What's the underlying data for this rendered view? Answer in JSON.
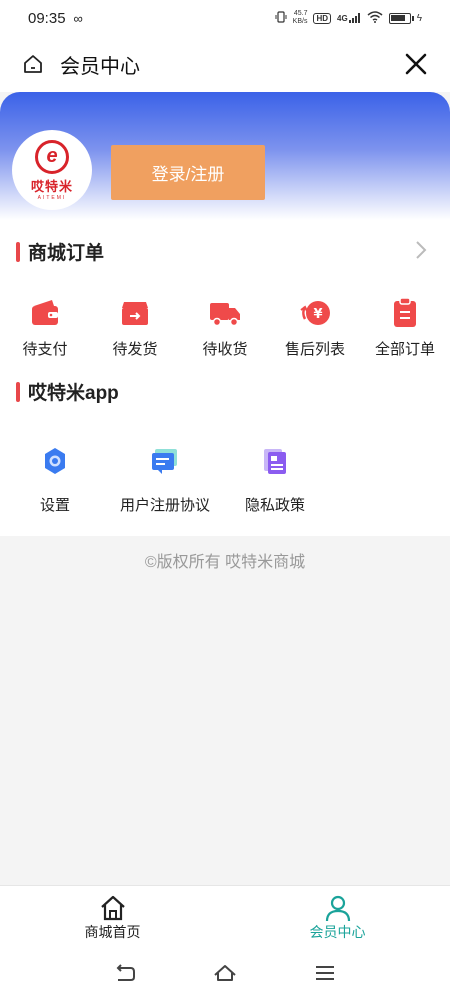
{
  "status_bar": {
    "time": "09:35",
    "net_speed_value": "45.7",
    "net_speed_unit": "KB/s",
    "hd": "HD",
    "signal": "4G"
  },
  "nav": {
    "title": "会员中心"
  },
  "header": {
    "logo_text": "哎特米",
    "logo_subtext": "AITEMI",
    "login_label": "登录/注册"
  },
  "orders": {
    "title": "商城订单",
    "items": [
      {
        "label": "待支付",
        "icon": "wallet-icon",
        "color": "#ef4a4a"
      },
      {
        "label": "待发货",
        "icon": "package-icon",
        "color": "#ef4a4a"
      },
      {
        "label": "待收货",
        "icon": "truck-icon",
        "color": "#ef4a4a"
      },
      {
        "label": "售后列表",
        "icon": "yen-refund-icon",
        "color": "#ef4a4a"
      },
      {
        "label": "全部订单",
        "icon": "clipboard-icon",
        "color": "#ef4a4a"
      }
    ]
  },
  "app_section": {
    "title": "哎特米app",
    "items": [
      {
        "label": "设置",
        "icon": "gear-icon",
        "color": "#3a7bf0"
      },
      {
        "label": "用户注册协议",
        "icon": "chat-doc-icon",
        "color": "#3a7bf0"
      },
      {
        "label": "隐私政策",
        "icon": "document-icon",
        "color": "#8b5cf0"
      }
    ]
  },
  "footer": {
    "copyright": "©版权所有 哎特米商城"
  },
  "tab_bar": {
    "tabs": [
      {
        "label": "商城首页",
        "icon": "home-icon",
        "active": false
      },
      {
        "label": "会员中心",
        "icon": "user-icon",
        "active": true
      }
    ],
    "active_color": "#1aa39a"
  }
}
